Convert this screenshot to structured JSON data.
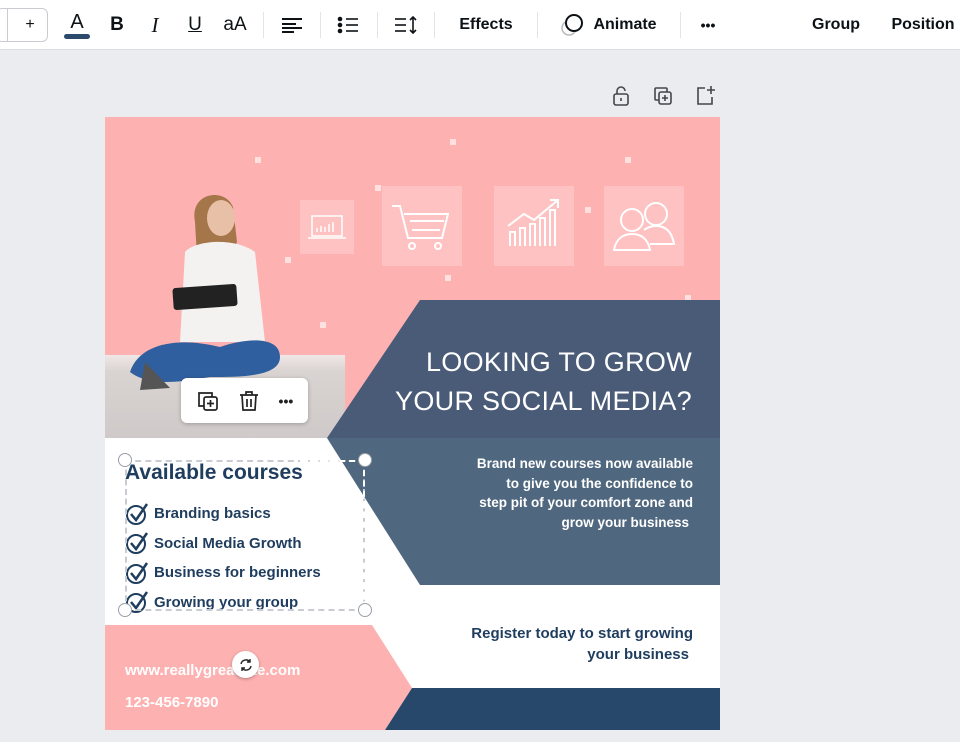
{
  "toolbar": {
    "plus": "+",
    "font_size_label": "aA",
    "effects": "Effects",
    "animate": "Animate",
    "more": "•••",
    "group": "Group",
    "position": "Position",
    "text_color": "#2c4a6b"
  },
  "icons": {
    "text_color": "text-color-icon",
    "bold": "bold-icon",
    "italic": "italic-icon",
    "underline": "underline-icon",
    "align": "align-left-icon",
    "list": "list-icon",
    "spacing": "line-spacing-icon",
    "lock": "lock-icon",
    "duplicate": "duplicate-icon",
    "add_page": "add-page-icon",
    "delete": "trash-icon",
    "rotate": "rotate-icon",
    "check": "check-circle-icon"
  },
  "poster": {
    "headline": [
      "LOOKING TO GROW",
      "YOUR SOCIAL MEDIA?"
    ],
    "description": [
      "Brand new courses now available",
      "to give you  the confidence to",
      "step pit of your comfort zone and",
      "grow your business"
    ],
    "courses_title": "Available courses",
    "courses": [
      "Branding basics",
      "Social Media Growth",
      "Business for beginners",
      "Growing your group"
    ],
    "register": [
      "Register today to start growing",
      "your business"
    ],
    "website": "www.reallygreatsite.com",
    "phone": "123-456-7890",
    "colors": {
      "pink": "#feb1b1",
      "slate": "#4f667f",
      "navy": "#27486a",
      "text_dark": "#1f3d5e"
    }
  },
  "floatbar": {
    "more": "•••"
  }
}
